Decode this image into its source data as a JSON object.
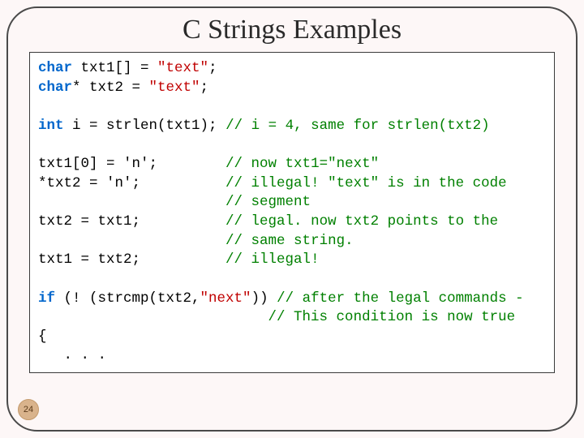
{
  "title": "C Strings Examples",
  "page_number": "24",
  "code": {
    "l1": {
      "kw": "char",
      "rest": " txt1[] = ",
      "str": "\"text\"",
      "end": ";"
    },
    "l2": {
      "kw": "char",
      "rest": "* txt2 = ",
      "str": "\"text\"",
      "end": ";"
    },
    "l3": {
      "kw": "int",
      "rest": " i = strlen(txt1); ",
      "cmt": "// i = 4, same for strlen(txt2)"
    },
    "l4": {
      "left": "txt1[0] = 'n';        ",
      "cmt": "// now txt1=\"next\""
    },
    "l5": {
      "left": "*txt2 = 'n';          ",
      "cmt": "// illegal! \"text\" is in the code"
    },
    "l6": {
      "left": "                      ",
      "cmt": "// segment"
    },
    "l7": {
      "left": "txt2 = txt1;          ",
      "cmt": "// legal. now txt2 points to the"
    },
    "l8": {
      "left": "                      ",
      "cmt": "// same string."
    },
    "l9": {
      "left": "txt1 = txt2;          ",
      "cmt": "// illegal!"
    },
    "l10": {
      "kw": "if",
      "rest": " (! (strcmp(txt2,",
      "str": "\"next\"",
      "rest2": ")) ",
      "cmt": "// after the legal commands -"
    },
    "l11": {
      "left": "                           ",
      "cmt": "// This condition is now true"
    },
    "l12": "{",
    "l13": "   . . ."
  }
}
